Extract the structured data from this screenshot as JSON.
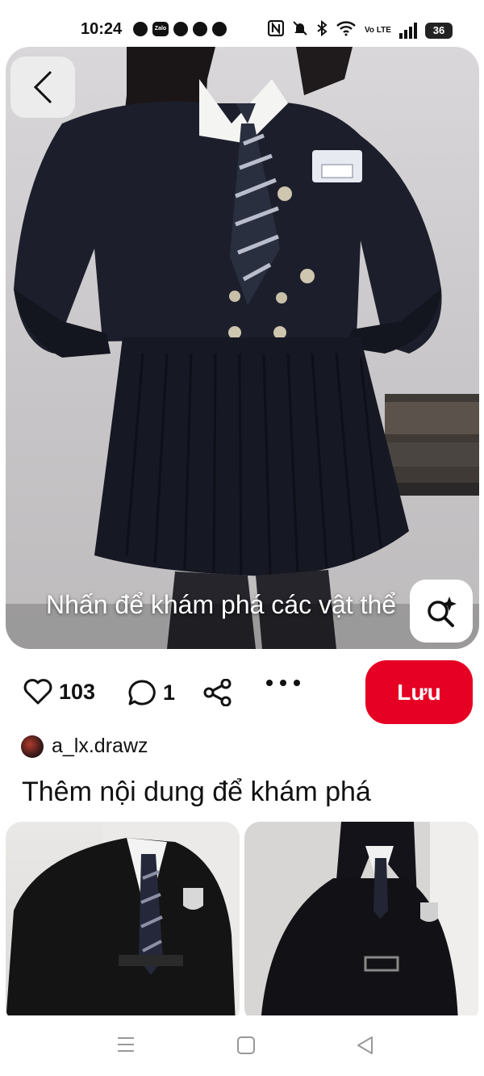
{
  "status_bar": {
    "time": "10:24",
    "notification_icons": [
      "chat-icon",
      "zalo-icon",
      "facebook-icon",
      "facebook-icon",
      "facebook-icon"
    ],
    "zalo_label": "Zalo",
    "system_icons": [
      "nfc-icon",
      "mute-icon",
      "bluetooth-icon",
      "wifi-icon",
      "volte-icon",
      "signal-icon",
      "battery-icon"
    ],
    "volte_label": "Vo LTE",
    "battery_level": "36"
  },
  "pin": {
    "image_subject": "girl in navy school uniform blazer, striped tie, pleated skirt",
    "visual_search_hint": "Nhấn để khám phá các vật thể",
    "likes_count": "103",
    "comments_count": "1",
    "save_label": "Lưu",
    "creator": {
      "username": "a_lx.drawz"
    }
  },
  "more_section": {
    "title": "Thêm nội dung để khám phá",
    "cards": [
      {
        "subject": "black school blazer with emblem and striped tie"
      },
      {
        "subject": "black cropped school jacket with emblem"
      }
    ]
  },
  "navigation_bar": {
    "buttons": [
      "menu-icon",
      "home-square-icon",
      "back-triangle-icon"
    ]
  },
  "colors": {
    "accent": "#e60023",
    "text": "#111111",
    "background": "#ffffff"
  }
}
